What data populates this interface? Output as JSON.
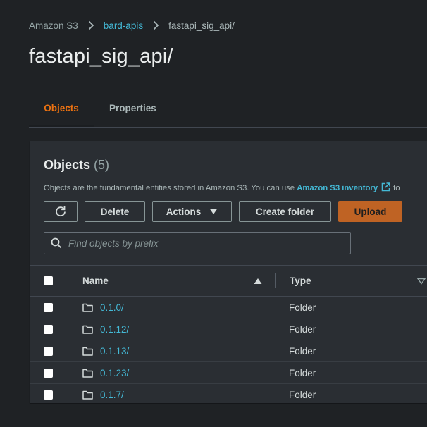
{
  "breadcrumb": {
    "items": [
      {
        "label": "Amazon S3"
      },
      {
        "label": "bard-apis"
      },
      {
        "label": "fastapi_sig_api/"
      }
    ]
  },
  "page": {
    "title": "fastapi_sig_api/"
  },
  "tabs": [
    {
      "label": "Objects",
      "active": true
    },
    {
      "label": "Properties",
      "active": false
    }
  ],
  "objects_panel": {
    "title": "Objects",
    "count": "(5)",
    "description": "Objects are the fundamental entities stored in Amazon S3. You can use",
    "inventory_link": "Amazon S3 inventory",
    "description_tail": "to"
  },
  "toolbar": {
    "refresh_icon": "refresh-icon",
    "delete_label": "Delete",
    "actions_label": "Actions",
    "create_folder_label": "Create folder",
    "upload_label": "Upload"
  },
  "search": {
    "placeholder": "Find objects by prefix",
    "value": ""
  },
  "table": {
    "columns": {
      "name": "Name",
      "type": "Type"
    },
    "rows": [
      {
        "name": "0.1.0/",
        "type": "Folder",
        "icon": "folder-icon"
      },
      {
        "name": "0.1.12/",
        "type": "Folder",
        "icon": "folder-icon"
      },
      {
        "name": "0.1.13/",
        "type": "Folder",
        "icon": "folder-icon"
      },
      {
        "name": "0.1.23/",
        "type": "Folder",
        "icon": "folder-icon"
      },
      {
        "name": "0.1.7/",
        "type": "Folder",
        "icon": "folder-icon"
      }
    ]
  },
  "colors": {
    "accent_tab": "#ec7211",
    "upload_button": "#bf6324",
    "link": "#44b9d6",
    "background": "#1f2225",
    "panel": "#2a2e33"
  }
}
